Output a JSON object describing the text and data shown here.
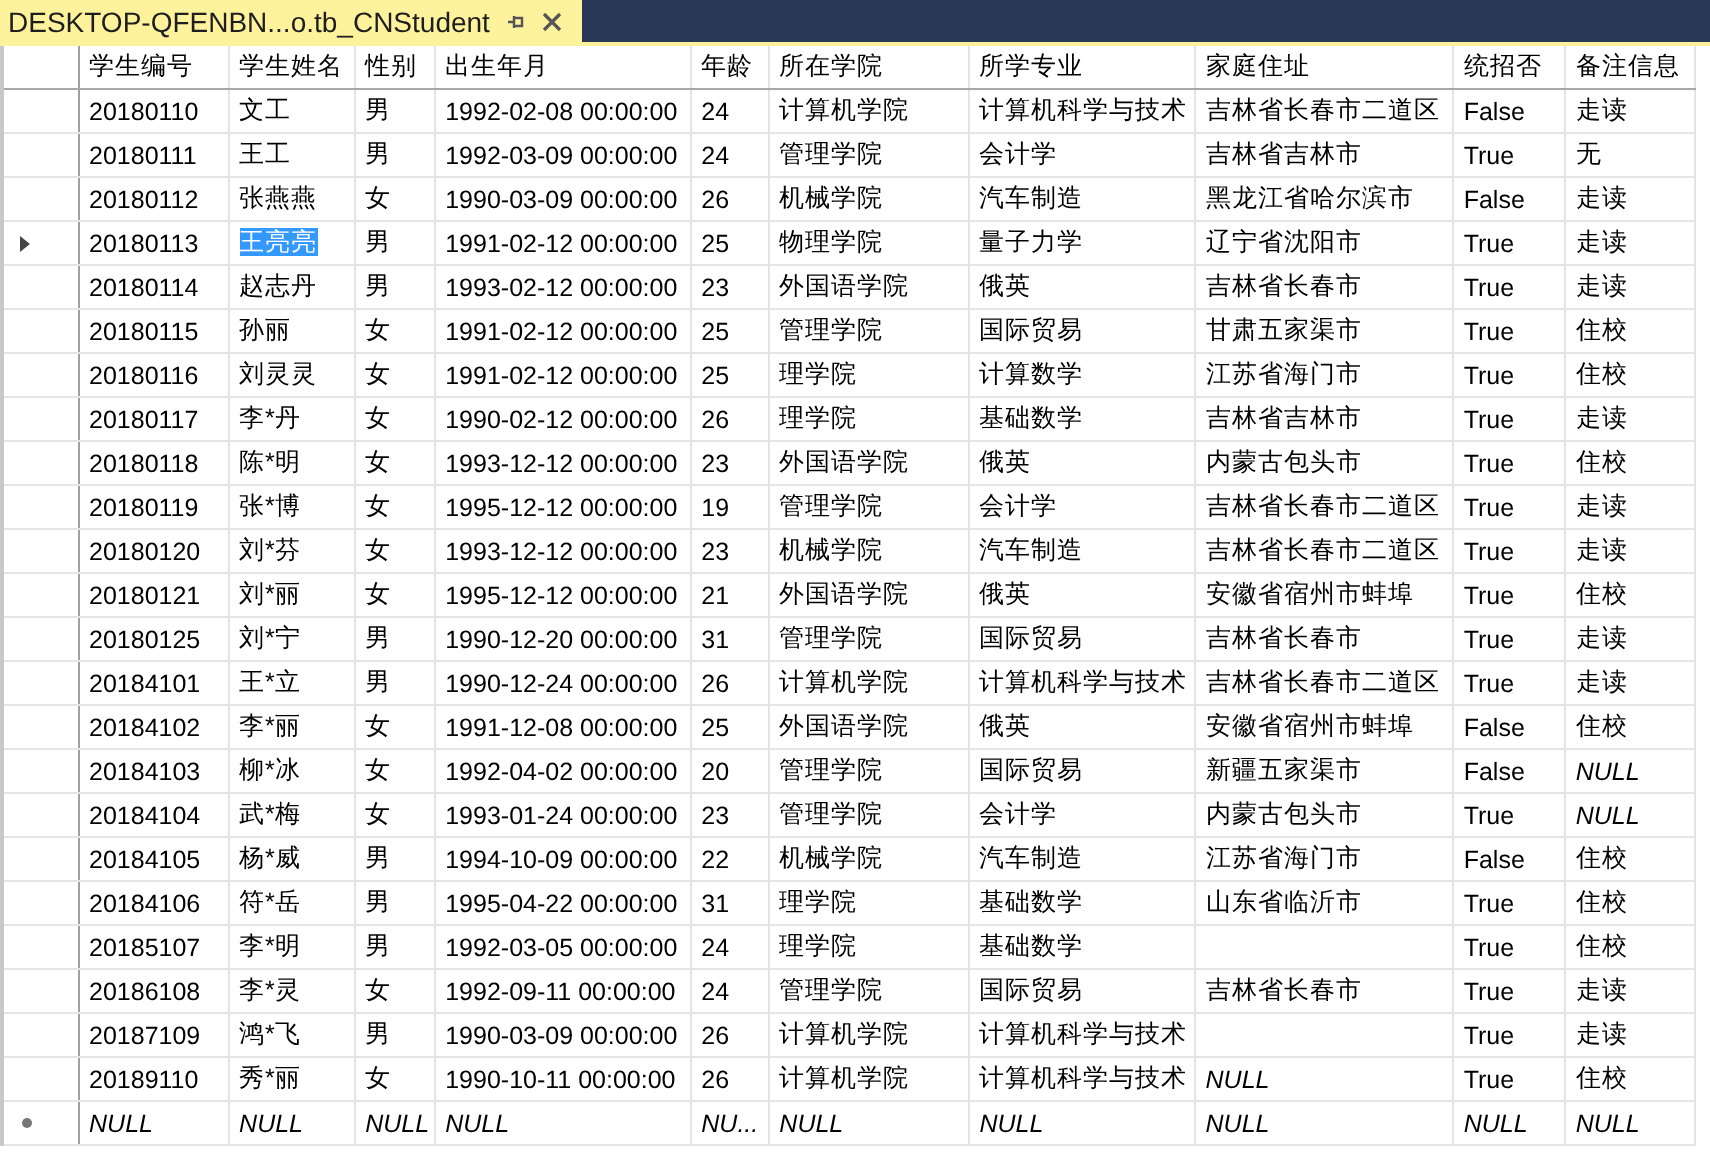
{
  "tab": {
    "title": "DESKTOP-QFENBN...o.tb_CNStudent",
    "pinned": true
  },
  "table": {
    "columns": [
      "学生编号",
      "学生姓名",
      "性别",
      "出生年月",
      "年龄",
      "所在学院",
      "所学专业",
      "家庭住址",
      "统招否",
      "备注信息"
    ],
    "rows": [
      {
        "cells": [
          "20180110",
          "文工",
          "男",
          "1992-02-08 00:00:00",
          "24",
          "计算机学院",
          "计算机科学与技术",
          "吉林省长春市二道区",
          "False",
          "走读"
        ]
      },
      {
        "cells": [
          "20180111",
          "王工",
          "男",
          "1992-03-09 00:00:00",
          "24",
          "管理学院",
          "会计学",
          "吉林省吉林市",
          "True",
          "无"
        ]
      },
      {
        "cells": [
          "20180112",
          "张燕燕",
          "女",
          "1990-03-09 00:00:00",
          "26",
          "机械学院",
          "汽车制造",
          "黑龙江省哈尔滨市",
          "False",
          "走读"
        ]
      },
      {
        "kind": "current",
        "cells": [
          "20180113",
          {
            "text": "王亮亮",
            "selected": true
          },
          "男",
          "1991-02-12 00:00:00",
          "25",
          "物理学院",
          "量子力学",
          "辽宁省沈阳市",
          "True",
          "走读"
        ]
      },
      {
        "cells": [
          "20180114",
          "赵志丹",
          "男",
          "1993-02-12 00:00:00",
          "23",
          "外国语学院",
          "俄英",
          "吉林省长春市",
          "True",
          "走读"
        ]
      },
      {
        "cells": [
          "20180115",
          "孙丽",
          "女",
          "1991-02-12 00:00:00",
          "25",
          "管理学院",
          "国际贸易",
          "甘肃五家渠市",
          "True",
          "住校"
        ]
      },
      {
        "cells": [
          "20180116",
          "刘灵灵",
          "女",
          "1991-02-12 00:00:00",
          "25",
          "理学院",
          "计算数学",
          "江苏省海门市",
          "True",
          "住校"
        ]
      },
      {
        "cells": [
          "20180117",
          "李*丹",
          "女",
          "1990-02-12 00:00:00",
          "26",
          "理学院",
          "基础数学",
          "吉林省吉林市",
          "True",
          "走读"
        ]
      },
      {
        "cells": [
          "20180118",
          "陈*明",
          "女",
          "1993-12-12 00:00:00",
          "23",
          "外国语学院",
          "俄英",
          "内蒙古包头市",
          "True",
          "住校"
        ]
      },
      {
        "cells": [
          "20180119",
          "张*博",
          "女",
          "1995-12-12 00:00:00",
          "19",
          "管理学院",
          "会计学",
          "吉林省长春市二道区",
          "True",
          "走读"
        ]
      },
      {
        "cells": [
          "20180120",
          "刘*芬",
          "女",
          "1993-12-12 00:00:00",
          "23",
          "机械学院",
          "汽车制造",
          "吉林省长春市二道区",
          "True",
          "走读"
        ]
      },
      {
        "cells": [
          "20180121",
          "刘*丽",
          "女",
          "1995-12-12 00:00:00",
          "21",
          "外国语学院",
          "俄英",
          "安徽省宿州市蚌埠",
          "True",
          "住校"
        ]
      },
      {
        "cells": [
          "20180125",
          "刘*宁",
          "男",
          "1990-12-20 00:00:00",
          "31",
          "管理学院",
          "国际贸易",
          "吉林省长春市",
          "True",
          "走读"
        ]
      },
      {
        "cells": [
          "20184101",
          "王*立",
          "男",
          "1990-12-24 00:00:00",
          "26",
          "计算机学院",
          "计算机科学与技术",
          "吉林省长春市二道区",
          "True",
          "走读"
        ]
      },
      {
        "cells": [
          "20184102",
          "李*丽",
          "女",
          "1991-12-08 00:00:00",
          "25",
          "外国语学院",
          "俄英",
          "安徽省宿州市蚌埠",
          "False",
          "住校"
        ]
      },
      {
        "cells": [
          "20184103",
          "柳*冰",
          "女",
          "1992-04-02 00:00:00",
          "20",
          "管理学院",
          "国际贸易",
          "新疆五家渠市",
          "False",
          {
            "text": "NULL",
            "kind": "null"
          }
        ]
      },
      {
        "cells": [
          "20184104",
          "武*梅",
          "女",
          "1993-01-24 00:00:00",
          "23",
          "管理学院",
          "会计学",
          "内蒙古包头市",
          "True",
          {
            "text": "NULL",
            "kind": "null"
          }
        ]
      },
      {
        "cells": [
          "20184105",
          "杨*威",
          "男",
          "1994-10-09 00:00:00",
          "22",
          "机械学院",
          "汽车制造",
          "江苏省海门市",
          "False",
          "住校"
        ]
      },
      {
        "cells": [
          "20184106",
          "符*岳",
          "男",
          "1995-04-22 00:00:00",
          "31",
          "理学院",
          "基础数学",
          "山东省临沂市",
          "True",
          "住校"
        ]
      },
      {
        "cells": [
          "20185107",
          "李*明",
          "男",
          "1992-03-05 00:00:00",
          "24",
          "理学院",
          "基础数学",
          null,
          "True",
          "住校"
        ]
      },
      {
        "cells": [
          "20186108",
          "李*灵",
          "女",
          "1992-09-11 00:00:00",
          "24",
          "管理学院",
          "国际贸易",
          "吉林省长春市",
          "True",
          "走读"
        ]
      },
      {
        "cells": [
          "20187109",
          "鸿*飞",
          "男",
          "1990-03-09 00:00:00",
          "26",
          "计算机学院",
          "计算机科学与技术",
          null,
          "True",
          "走读"
        ]
      },
      {
        "cells": [
          "20189110",
          "秀*丽",
          "女",
          "1990-10-11 00:00:00",
          "26",
          "计算机学院",
          "计算机科学与技术",
          {
            "text": "NULL",
            "kind": "null"
          },
          "True",
          "住校"
        ]
      },
      {
        "kind": "new",
        "cells": [
          {
            "text": "NULL",
            "kind": "null"
          },
          {
            "text": "NULL",
            "kind": "null"
          },
          {
            "text": "NULL",
            "kind": "null"
          },
          {
            "text": "NULL",
            "kind": "null"
          },
          {
            "text": "NU...",
            "kind": "null"
          },
          {
            "text": "NULL",
            "kind": "null"
          },
          {
            "text": "NULL",
            "kind": "null"
          },
          {
            "text": "NULL",
            "kind": "null"
          },
          {
            "text": "NULL",
            "kind": "null"
          },
          {
            "text": "NULL",
            "kind": "null"
          }
        ]
      }
    ]
  }
}
